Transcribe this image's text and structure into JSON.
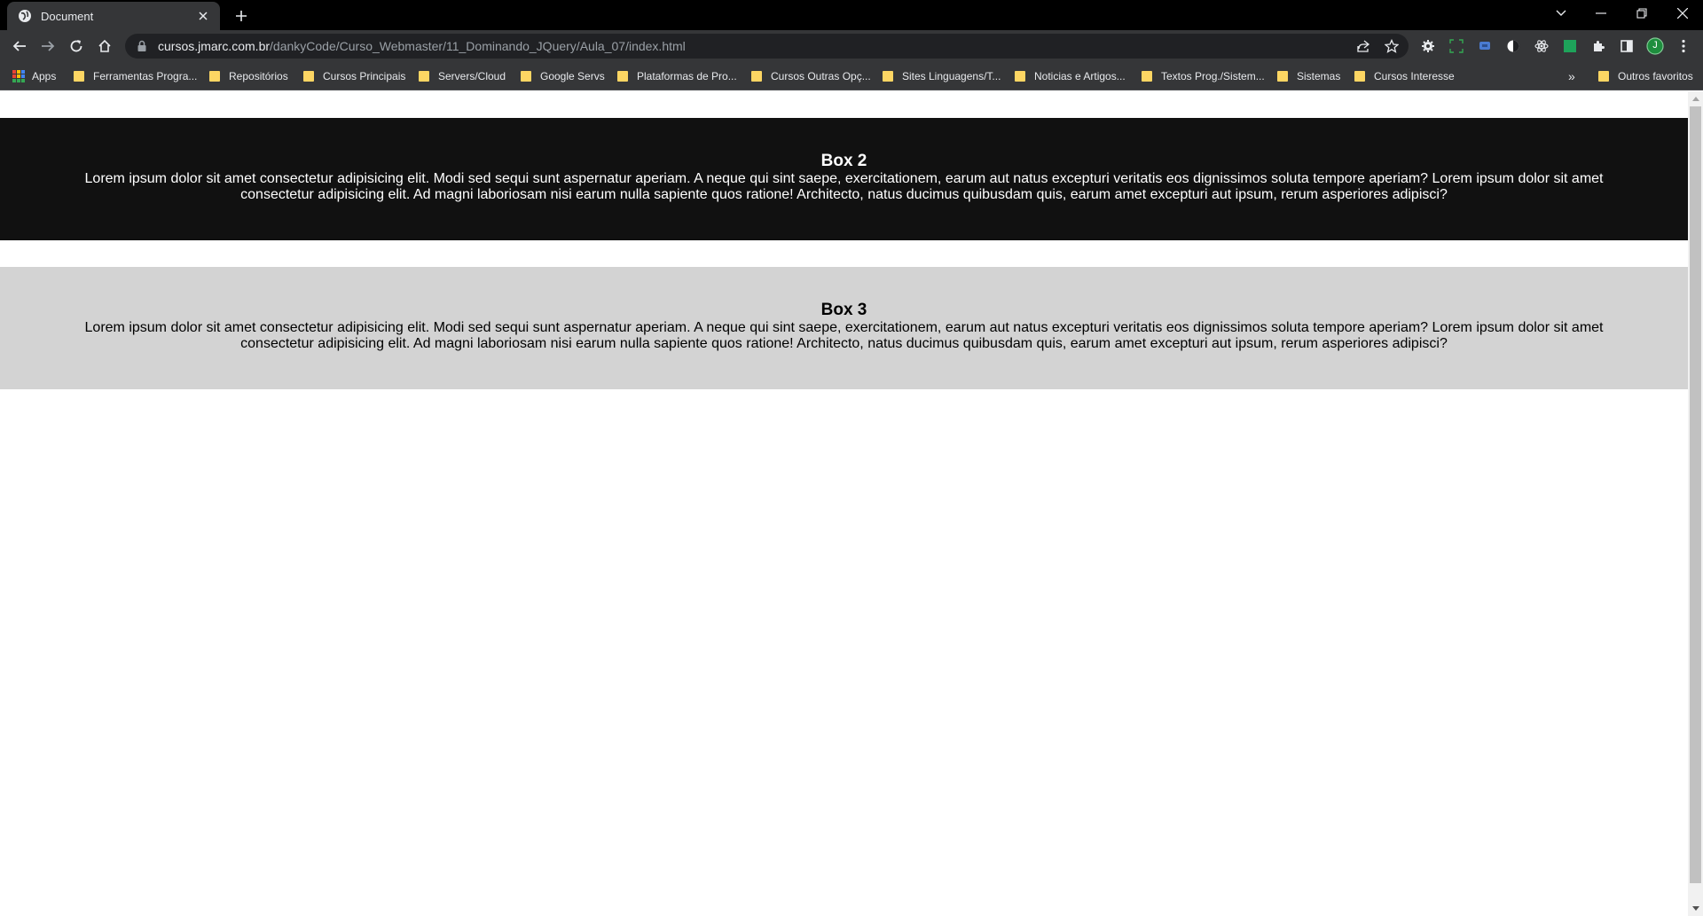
{
  "browser": {
    "tab": {
      "title": "Document"
    },
    "address": {
      "host": "cursos.jmarc.com.br",
      "path": "/dankyCode/Curso_Webmaster/11_Dominando_JQuery/Aula_07/index.html"
    },
    "profile_initial": "J",
    "bookmarks": [
      {
        "label": "Apps",
        "icon": "apps-grid-icon"
      },
      {
        "label": "Ferramentas Progra...",
        "icon": "folder-icon"
      },
      {
        "label": "Repositórios",
        "icon": "folder-icon"
      },
      {
        "label": "Cursos Principais",
        "icon": "folder-icon"
      },
      {
        "label": "Servers/Cloud",
        "icon": "folder-icon"
      },
      {
        "label": "Google Servs",
        "icon": "folder-icon"
      },
      {
        "label": "Plataformas de Pro...",
        "icon": "folder-icon"
      },
      {
        "label": "Cursos Outras Opç...",
        "icon": "folder-icon"
      },
      {
        "label": "Sites Linguagens/T...",
        "icon": "folder-icon"
      },
      {
        "label": "Noticias e Artigos...",
        "icon": "folder-icon"
      },
      {
        "label": "Textos Prog./Sistem...",
        "icon": "folder-icon"
      },
      {
        "label": "Sistemas",
        "icon": "folder-icon"
      },
      {
        "label": "Cursos Interesse",
        "icon": "folder-icon"
      }
    ],
    "overflow_label": "»",
    "other_bookmarks": "Outros favoritos"
  },
  "page": {
    "box2": {
      "title": "Box 2",
      "text": "Lorem ipsum dolor sit amet consectetur adipisicing elit. Modi sed sequi sunt aspernatur aperiam. A neque qui sint saepe, exercitationem, earum aut natus excepturi veritatis eos dignissimos soluta tempore aperiam? Lorem ipsum dolor sit amet consectetur adipisicing elit. Ad magni laboriosam nisi earum nulla sapiente quos ratione! Architecto, natus ducimus quibusdam quis, earum amet excepturi aut ipsum, rerum asperiores adipisci?"
    },
    "box3": {
      "title": "Box 3",
      "text": "Lorem ipsum dolor sit amet consectetur adipisicing elit. Modi sed sequi sunt aspernatur aperiam. A neque qui sint saepe, exercitationem, earum aut natus excepturi veritatis eos dignissimos soluta tempore aperiam? Lorem ipsum dolor sit amet consectetur adipisicing elit. Ad magni laboriosam nisi earum nulla sapiente quos ratione! Architecto, natus ducimus quibusdam quis, earum amet excepturi aut ipsum, rerum asperiores adipisci?"
    }
  },
  "colors": {
    "box2_bg": "#111111",
    "box3_bg": "#d3d3d3",
    "chrome_bg": "#353638",
    "folder": "#fdd663"
  }
}
